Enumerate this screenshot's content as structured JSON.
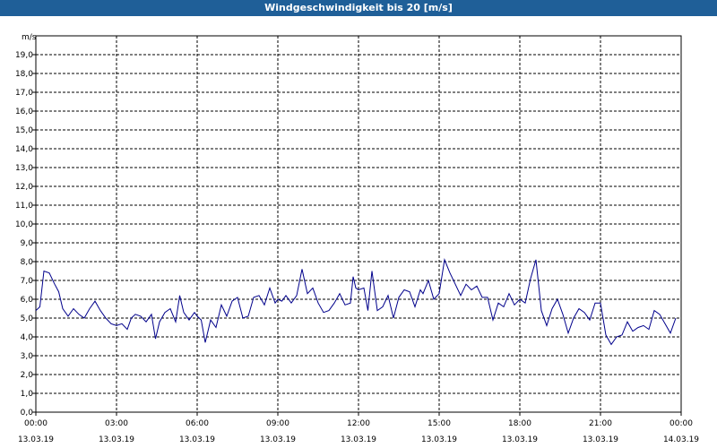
{
  "header": {
    "title": "Windgeschwindigkeit bis 20 [m/s]"
  },
  "colors": {
    "titlebar": "#1f5f98",
    "line": "#00008b",
    "grid": "#000000"
  },
  "chart_data": {
    "type": "line",
    "title": "Windgeschwindigkeit bis 20 [m/s]",
    "ylabel": "m/s",
    "xlabel": "",
    "ylim": [
      0,
      20
    ],
    "ytick_step": 1,
    "yticks": [
      "0,0",
      "1,0",
      "2,0",
      "3,0",
      "4,0",
      "5,0",
      "6,0",
      "7,0",
      "8,0",
      "9,0",
      "10,0",
      "11,0",
      "12,0",
      "13,0",
      "14,0",
      "15,0",
      "16,0",
      "17,0",
      "18,0",
      "19,0"
    ],
    "xlim_hours": [
      0,
      24
    ],
    "xticks": [
      {
        "time": "00:00",
        "date": "13.03.19"
      },
      {
        "time": "03:00",
        "date": "13.03.19"
      },
      {
        "time": "06:00",
        "date": "13.03.19"
      },
      {
        "time": "09:00",
        "date": "13.03.19"
      },
      {
        "time": "12:00",
        "date": "13.03.19"
      },
      {
        "time": "15:00",
        "date": "13.03.19"
      },
      {
        "time": "18:00",
        "date": "13.03.19"
      },
      {
        "time": "21:00",
        "date": "13.03.19"
      },
      {
        "time": "00:00",
        "date": "14.03.19"
      }
    ],
    "grid": true,
    "series": [
      {
        "x_hours": [
          0,
          0.15,
          0.3,
          0.5,
          0.7,
          0.85,
          1.0,
          1.2,
          1.4,
          1.6,
          1.8,
          2.0,
          2.2,
          2.4,
          2.6,
          2.8,
          3.0,
          3.2,
          3.4,
          3.55,
          3.7,
          3.9,
          4.1,
          4.3,
          4.45,
          4.6,
          4.8,
          5.0,
          5.2,
          5.35,
          5.5,
          5.7,
          5.9,
          6.0,
          6.15,
          6.3,
          6.5,
          6.7,
          6.9,
          7.1,
          7.3,
          7.5,
          7.7,
          7.9,
          8.1,
          8.3,
          8.5,
          8.7,
          8.9,
          9.0,
          9.15,
          9.3,
          9.5,
          9.7,
          9.9,
          10.1,
          10.3,
          10.5,
          10.7,
          10.9,
          11.1,
          11.3,
          11.5,
          11.7,
          11.8,
          11.9,
          12.0,
          12.2,
          12.35,
          12.5,
          12.7,
          12.9,
          13.1,
          13.3,
          13.5,
          13.7,
          13.9,
          14.1,
          14.3,
          14.4,
          14.6,
          14.8,
          15.0,
          15.2,
          15.4,
          15.6,
          15.8,
          16.0,
          16.2,
          16.4,
          16.6,
          16.8,
          17.0,
          17.2,
          17.4,
          17.6,
          17.8,
          18.0,
          18.2,
          18.4,
          18.6,
          18.8,
          19.0,
          19.2,
          19.4,
          19.6,
          19.8,
          20.0,
          20.2,
          20.4,
          20.6,
          20.8,
          21.0,
          21.2,
          21.4,
          21.6,
          21.8,
          22.0,
          22.2,
          22.4,
          22.6,
          22.8,
          23.0,
          23.2,
          23.4,
          23.6,
          23.8
        ],
        "values": [
          5.4,
          5.6,
          7.5,
          7.4,
          6.8,
          6.4,
          5.5,
          5.1,
          5.5,
          5.2,
          5.0,
          5.5,
          5.9,
          5.4,
          5.0,
          4.7,
          4.6,
          4.7,
          4.4,
          5.0,
          5.2,
          5.1,
          4.8,
          5.2,
          3.9,
          4.8,
          5.3,
          5.5,
          4.8,
          6.2,
          5.3,
          4.9,
          5.3,
          5.1,
          4.9,
          3.7,
          4.9,
          4.5,
          5.7,
          5.1,
          5.9,
          6.1,
          5.0,
          5.1,
          6.1,
          6.2,
          5.7,
          6.6,
          5.8,
          6.0,
          5.9,
          6.2,
          5.8,
          6.2,
          7.6,
          6.3,
          6.6,
          5.8,
          5.3,
          5.4,
          5.8,
          6.3,
          5.7,
          5.8,
          7.2,
          6.6,
          6.5,
          6.6,
          5.4,
          7.5,
          5.4,
          5.6,
          6.2,
          5.0,
          6.1,
          6.5,
          6.4,
          5.6,
          6.5,
          6.3,
          7.0,
          6.0,
          6.3,
          8.1,
          7.4,
          6.8,
          6.2,
          6.8,
          6.5,
          6.7,
          6.1,
          6.1,
          4.9,
          5.8,
          5.6,
          6.3,
          5.7,
          6.0,
          5.8,
          7.1,
          8.1,
          5.4,
          4.6,
          5.5,
          6.0,
          5.2,
          4.2,
          5.0,
          5.5,
          5.3,
          4.9,
          5.8,
          5.8,
          4.1,
          3.6,
          4.0,
          4.1,
          4.8,
          4.3,
          4.5,
          4.6,
          4.4,
          5.4,
          5.2,
          4.7,
          4.2,
          5.0,
          4.4,
          5.0,
          5.4,
          5.7,
          5.2,
          5.4
        ]
      }
    ]
  }
}
